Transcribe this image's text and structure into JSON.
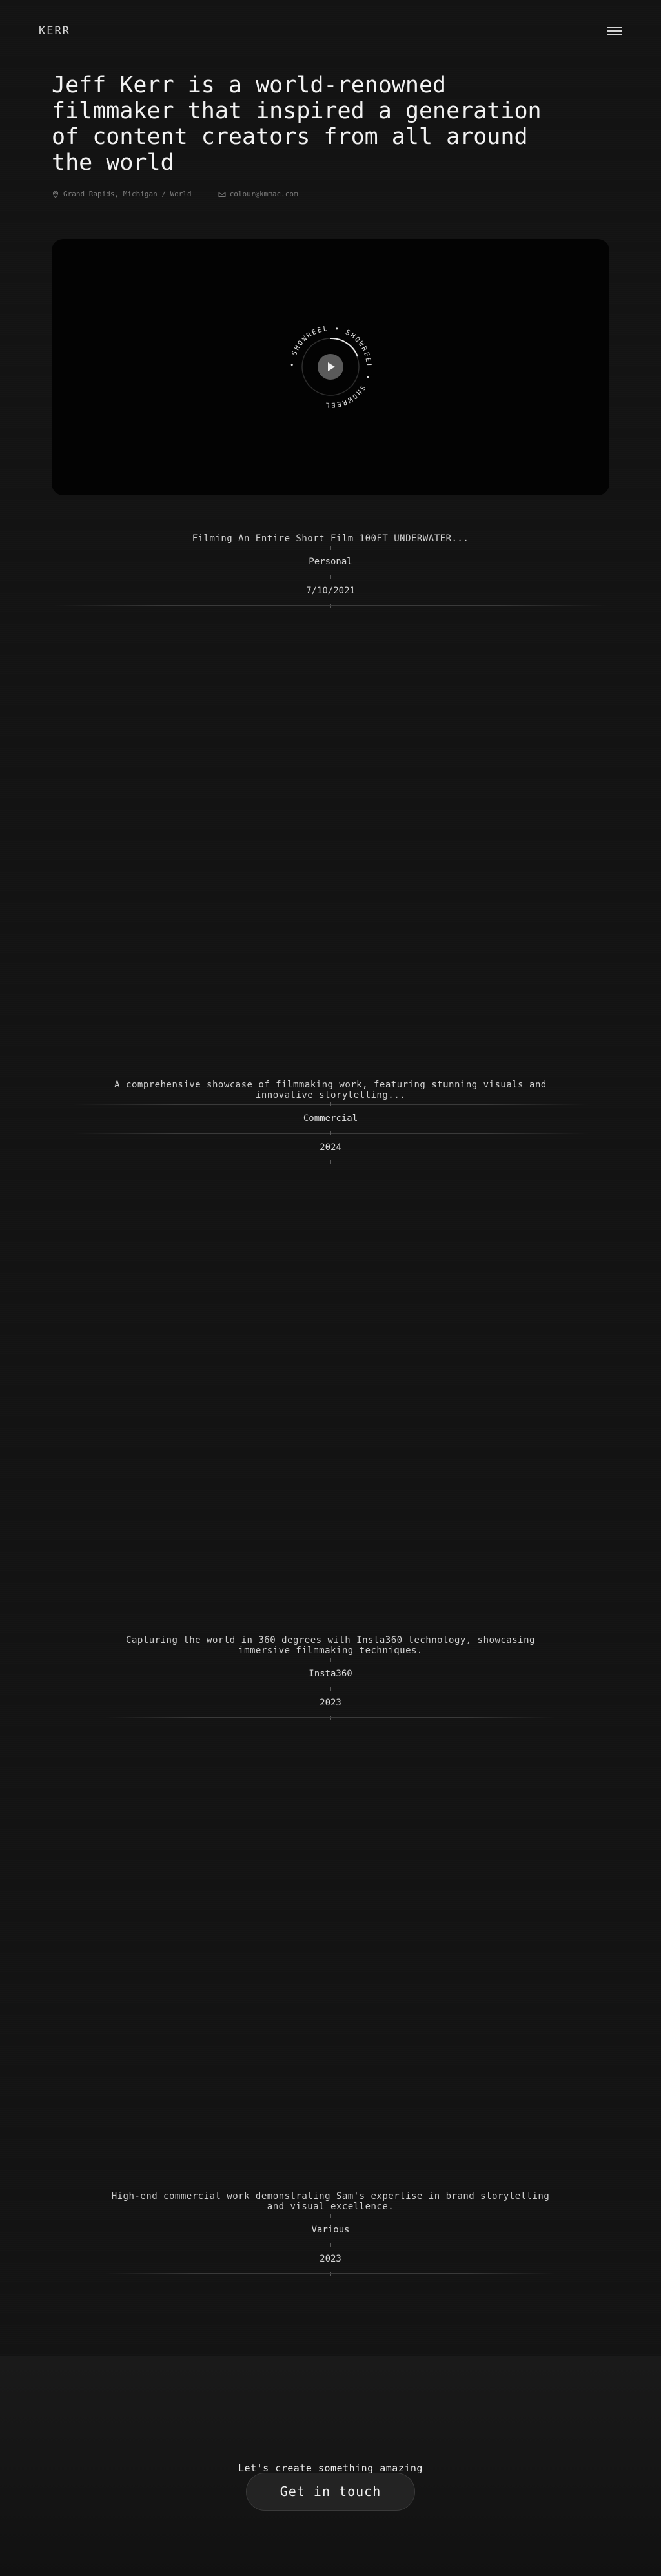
{
  "header": {
    "logo": "KERR",
    "menu_icon": "hamburger-menu-icon"
  },
  "hero": {
    "headline": "Jeff Kerr is a world-renowned filmmaker that inspired a generation of content creators from all around the world",
    "location": "Grand Rapids, Michigan / World",
    "email": "colour@kmmac.com",
    "location_icon": "map-pin-icon",
    "email_icon": "mail-icon"
  },
  "showreel": {
    "ring_text": "• SHOWREEL • SHOWREEL • SHOWREEL",
    "play_icon": "play-icon"
  },
  "projects": [
    {
      "title": "Filming An Entire Short Film 100FT UNDERWATER...",
      "category": "Personal",
      "date": "7/10/2021"
    },
    {
      "title": "A comprehensive showcase of filmmaking work, featuring stunning visuals and innovative storytelling...",
      "category": "Commercial",
      "date": "2024"
    },
    {
      "title": "Capturing the world in 360 degrees with Insta360 technology, showcasing immersive filmmaking techniques.",
      "category": "Insta360",
      "date": "2023"
    },
    {
      "title": "High-end commercial work demonstrating Sam's expertise in brand storytelling and visual excellence.",
      "category": "Various",
      "date": "2023"
    }
  ],
  "footer": {
    "tagline": "Let's create something amazing",
    "cta_label": "Get in touch"
  },
  "colors": {
    "background": "#131313",
    "text": "#e8e8e8",
    "muted": "#7a7a7a"
  }
}
